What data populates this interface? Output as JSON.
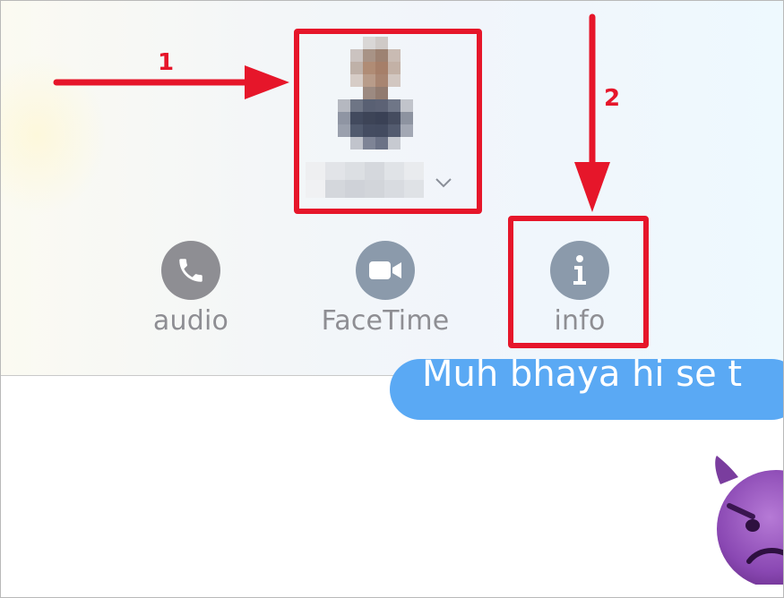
{
  "actions": {
    "audio": {
      "label": "audio",
      "color": "#8e8e93"
    },
    "facetime": {
      "label": "FaceTime",
      "color": "#8b9aab"
    },
    "info": {
      "label": "info",
      "color": "#8b9aab"
    }
  },
  "message": {
    "partial_text": "Muh bhaya hi se t",
    "bubble_color": "#5aa9f4"
  },
  "emoji": {
    "name": "smiling-face-with-horns-angry"
  },
  "annotations": {
    "step_1": "1",
    "step_2": "2",
    "color": "#e6162a"
  }
}
